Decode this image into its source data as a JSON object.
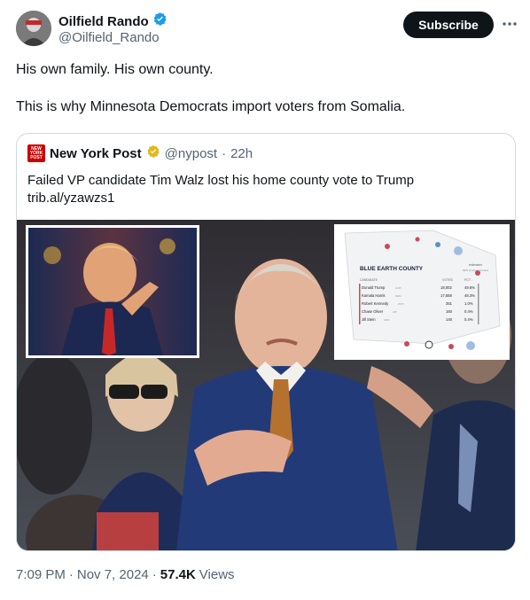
{
  "author": {
    "display_name": "Oilfield Rando",
    "handle": "@Oilfield_Rando",
    "verified": true,
    "verified_color": "#1d9bf0"
  },
  "actions": {
    "subscribe_label": "Subscribe",
    "more_icon": "more-horizontal-icon"
  },
  "tweet": {
    "lines": [
      "His own family. His own county.",
      "This is why Minnesota Democrats import voters from Somalia."
    ]
  },
  "quote": {
    "logo_lines": [
      "NEW",
      "YORK",
      "POST"
    ],
    "display_name": "New York Post",
    "verified_color": "#e2b719",
    "handle": "@nypost",
    "separator": "·",
    "time": "22h",
    "text": "Failed VP candidate Tim Walz lost his home county vote to Trump trib.al/yzawzs1",
    "media": {
      "map_title": "BLUE EARTH COUNTY",
      "map_legend": "estimates",
      "map_sub": "99% of votes counted",
      "columns": [
        "CANDIDATE",
        "VOTES",
        "PCT."
      ],
      "rows": [
        {
          "name": "Donald Trump",
          "party": "GOP",
          "votes": "18,002",
          "pct": "49.6%"
        },
        {
          "name": "Kamala Harris",
          "party": "DEM",
          "votes": "17,558",
          "pct": "48.3%"
        },
        {
          "name": "Robert Kennedy",
          "party": "WTP",
          "votes": "351",
          "pct": "1.0%"
        },
        {
          "name": "Chase Oliver",
          "party": "LIB",
          "votes": "160",
          "pct": "0.4%"
        },
        {
          "name": "Jill Stein",
          "party": "GRN",
          "votes": "140",
          "pct": "0.4%"
        }
      ]
    }
  },
  "meta": {
    "time": "7:09 PM",
    "separator": "·",
    "date": "Nov 7, 2024",
    "views_count": "57.4K",
    "views_label": "Views"
  }
}
